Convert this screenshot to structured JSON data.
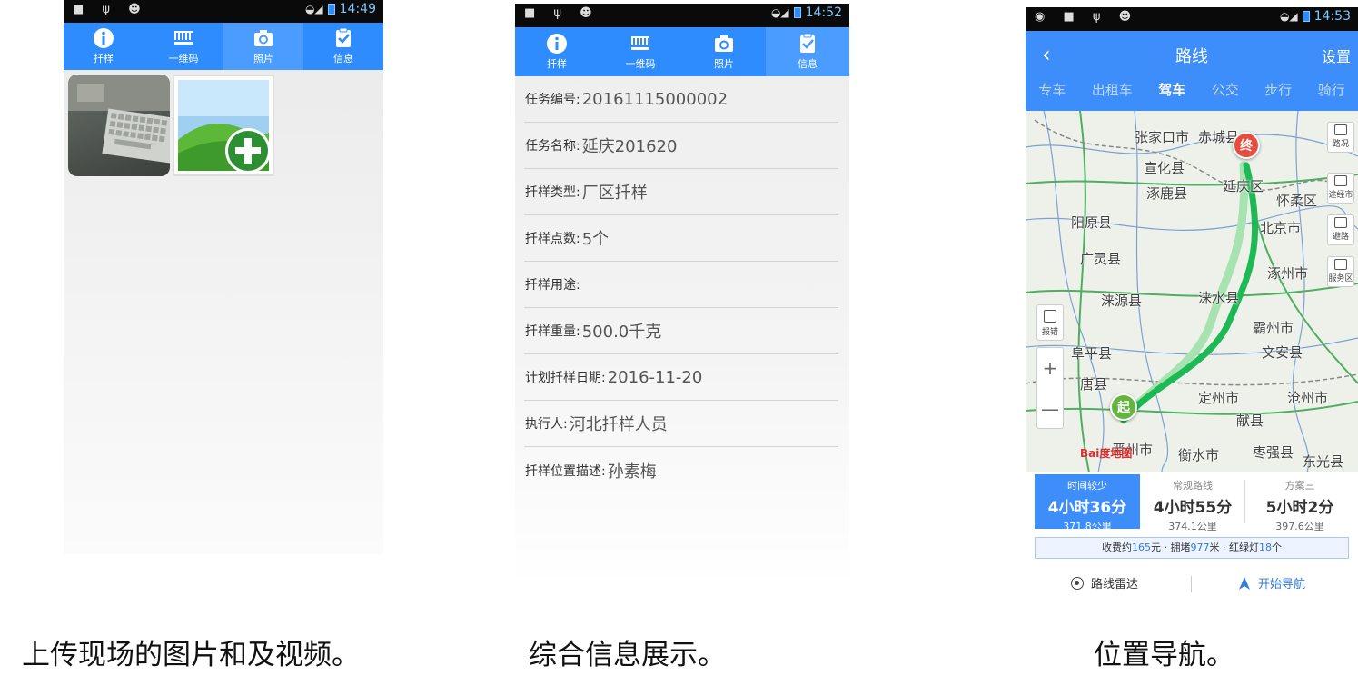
{
  "captions": {
    "upload": "上传现场的图片和及视频。",
    "info": "综合信息展示。",
    "nav": "位置导航。"
  },
  "screen_upload": {
    "status_time": "14:49",
    "tabs": [
      {
        "label": "扦样",
        "icon": "info-icon"
      },
      {
        "label": "一维码",
        "icon": "barcode-icon"
      },
      {
        "label": "照片",
        "icon": "camera-icon"
      },
      {
        "label": "信息",
        "icon": "clipboard-check-icon"
      }
    ],
    "active_tab": "照片"
  },
  "screen_info": {
    "status_time": "14:52",
    "tabs": [
      {
        "label": "扦样",
        "icon": "info-icon"
      },
      {
        "label": "一维码",
        "icon": "barcode-icon"
      },
      {
        "label": "照片",
        "icon": "camera-icon"
      },
      {
        "label": "信息",
        "icon": "clipboard-check-icon"
      }
    ],
    "active_tab": "信息",
    "fields": [
      {
        "label": "任务编号:",
        "value": "20161115000002"
      },
      {
        "label": "任务名称:",
        "value": "延庆201620"
      },
      {
        "label": "扦样类型:",
        "value": "厂区扦样"
      },
      {
        "label": "扦样点数:",
        "value": "5个"
      },
      {
        "label": "扦样用途:",
        "value": ""
      },
      {
        "label": "扦样重量:",
        "value": "500.0千克"
      },
      {
        "label": "计划扦样日期:",
        "value": "2016-11-20"
      },
      {
        "label": "执行人:",
        "value": "河北扦样人员"
      },
      {
        "label": "扦样位置描述:",
        "value": "孙素梅"
      }
    ]
  },
  "screen_nav": {
    "status_time": "14:53",
    "back": "‹",
    "title": "路线",
    "settings": "设置",
    "modes": [
      "专车",
      "出租车",
      "驾车",
      "公交",
      "步行",
      "骑行"
    ],
    "active_mode": "驾车",
    "map": {
      "cities": [
        "张家口市",
        "赤城县",
        "宣化县",
        "涿鹿县",
        "延庆区",
        "怀柔区",
        "阳原县",
        "北京市",
        "广灵县",
        "涞源县",
        "涞水县",
        "涿州市",
        "阜平县",
        "霸州市",
        "文安县",
        "唐县",
        "定州市",
        "献县",
        "沧州市",
        "晋州市",
        "衡水市",
        "枣强县",
        "东光县"
      ],
      "end_marker": "终",
      "start_marker": "起",
      "side_buttons": [
        "路况",
        "途经市",
        "避路",
        "服务区"
      ],
      "report": "报错",
      "zoom_in": "+",
      "zoom_out": "—",
      "logo": "Bai度地图"
    },
    "routes": [
      {
        "name": "时间较少",
        "time": "4小时36分",
        "distance": "371.8公里"
      },
      {
        "name": "常规路线",
        "time": "4小时55分",
        "distance": "374.1公里"
      },
      {
        "name": "方案三",
        "time": "5小时2分",
        "distance": "397.6公里"
      }
    ],
    "active_route": 0,
    "fee_prefix": "收费约",
    "fee": "165",
    "fee_unit": "元 · 拥堵",
    "jam": "977",
    "jam_unit": "米 · 红绿灯",
    "lights": "18",
    "lights_unit": "个",
    "radar_label": "路线雷达",
    "start_nav_label": "开始导航"
  }
}
